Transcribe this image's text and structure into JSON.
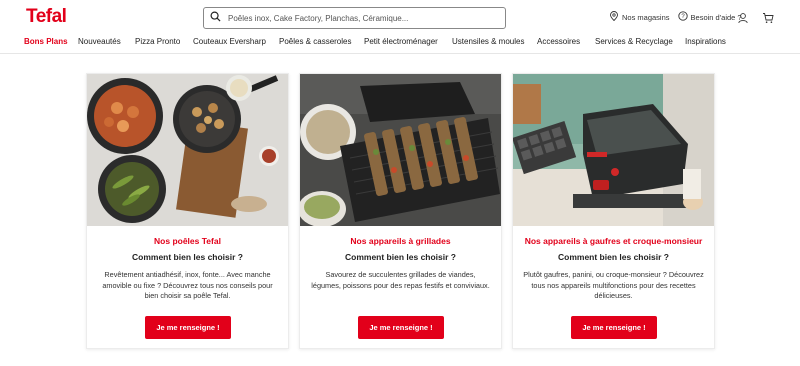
{
  "header": {
    "logo": "Tefal",
    "search_placeholder": "Poêles inox, Cake Factory, Planchas, Céramique...",
    "stores_label": "Nos magasins",
    "help_label": "Besoin d'aide ?",
    "icons": [
      "search-icon",
      "location-pin-icon",
      "help-circle-icon",
      "user-icon",
      "cart-icon"
    ]
  },
  "nav": {
    "items": [
      {
        "label": "Bons Plans",
        "active": true
      },
      {
        "label": "Nouveautés"
      },
      {
        "label": "Pizza Pronto"
      },
      {
        "label": "Couteaux Eversharp"
      },
      {
        "label": "Poêles & casseroles"
      },
      {
        "label": "Petit électroménager"
      },
      {
        "label": "Ustensiles & moules"
      },
      {
        "label": "Accessoires"
      },
      {
        "label": "Services & Recyclage"
      },
      {
        "label": "Inspirations"
      }
    ]
  },
  "cards": [
    {
      "title": "Nos poêles Tefal",
      "subtitle": "Comment bien les choisir ?",
      "text": "Revêtement antiadhésif, inox, fonte... Avec manche amovible ou fixe ? Découvrez tous nos conseils pour bien choisir sa poêle Tefal.",
      "button": "Je me renseigne !"
    },
    {
      "title": "Nos appareils à grillades",
      "subtitle": "Comment bien les choisir ?",
      "text": "Savourez de succulentes grillades de viandes, légumes, poissons pour des repas festifs et conviviaux.",
      "button": "Je me renseigne !"
    },
    {
      "title": "Nos appareils à gaufres et croque-monsieur",
      "subtitle": "Comment bien les choisir ?",
      "text": "Plutôt gaufres, panini, ou croque-monsieur ? Découvrez tous nos appareils multifonctions pour des recettes délicieuses.",
      "button": "Je me renseigne !"
    }
  ],
  "colors": {
    "brand": "#e2001a",
    "text": "#222222"
  }
}
